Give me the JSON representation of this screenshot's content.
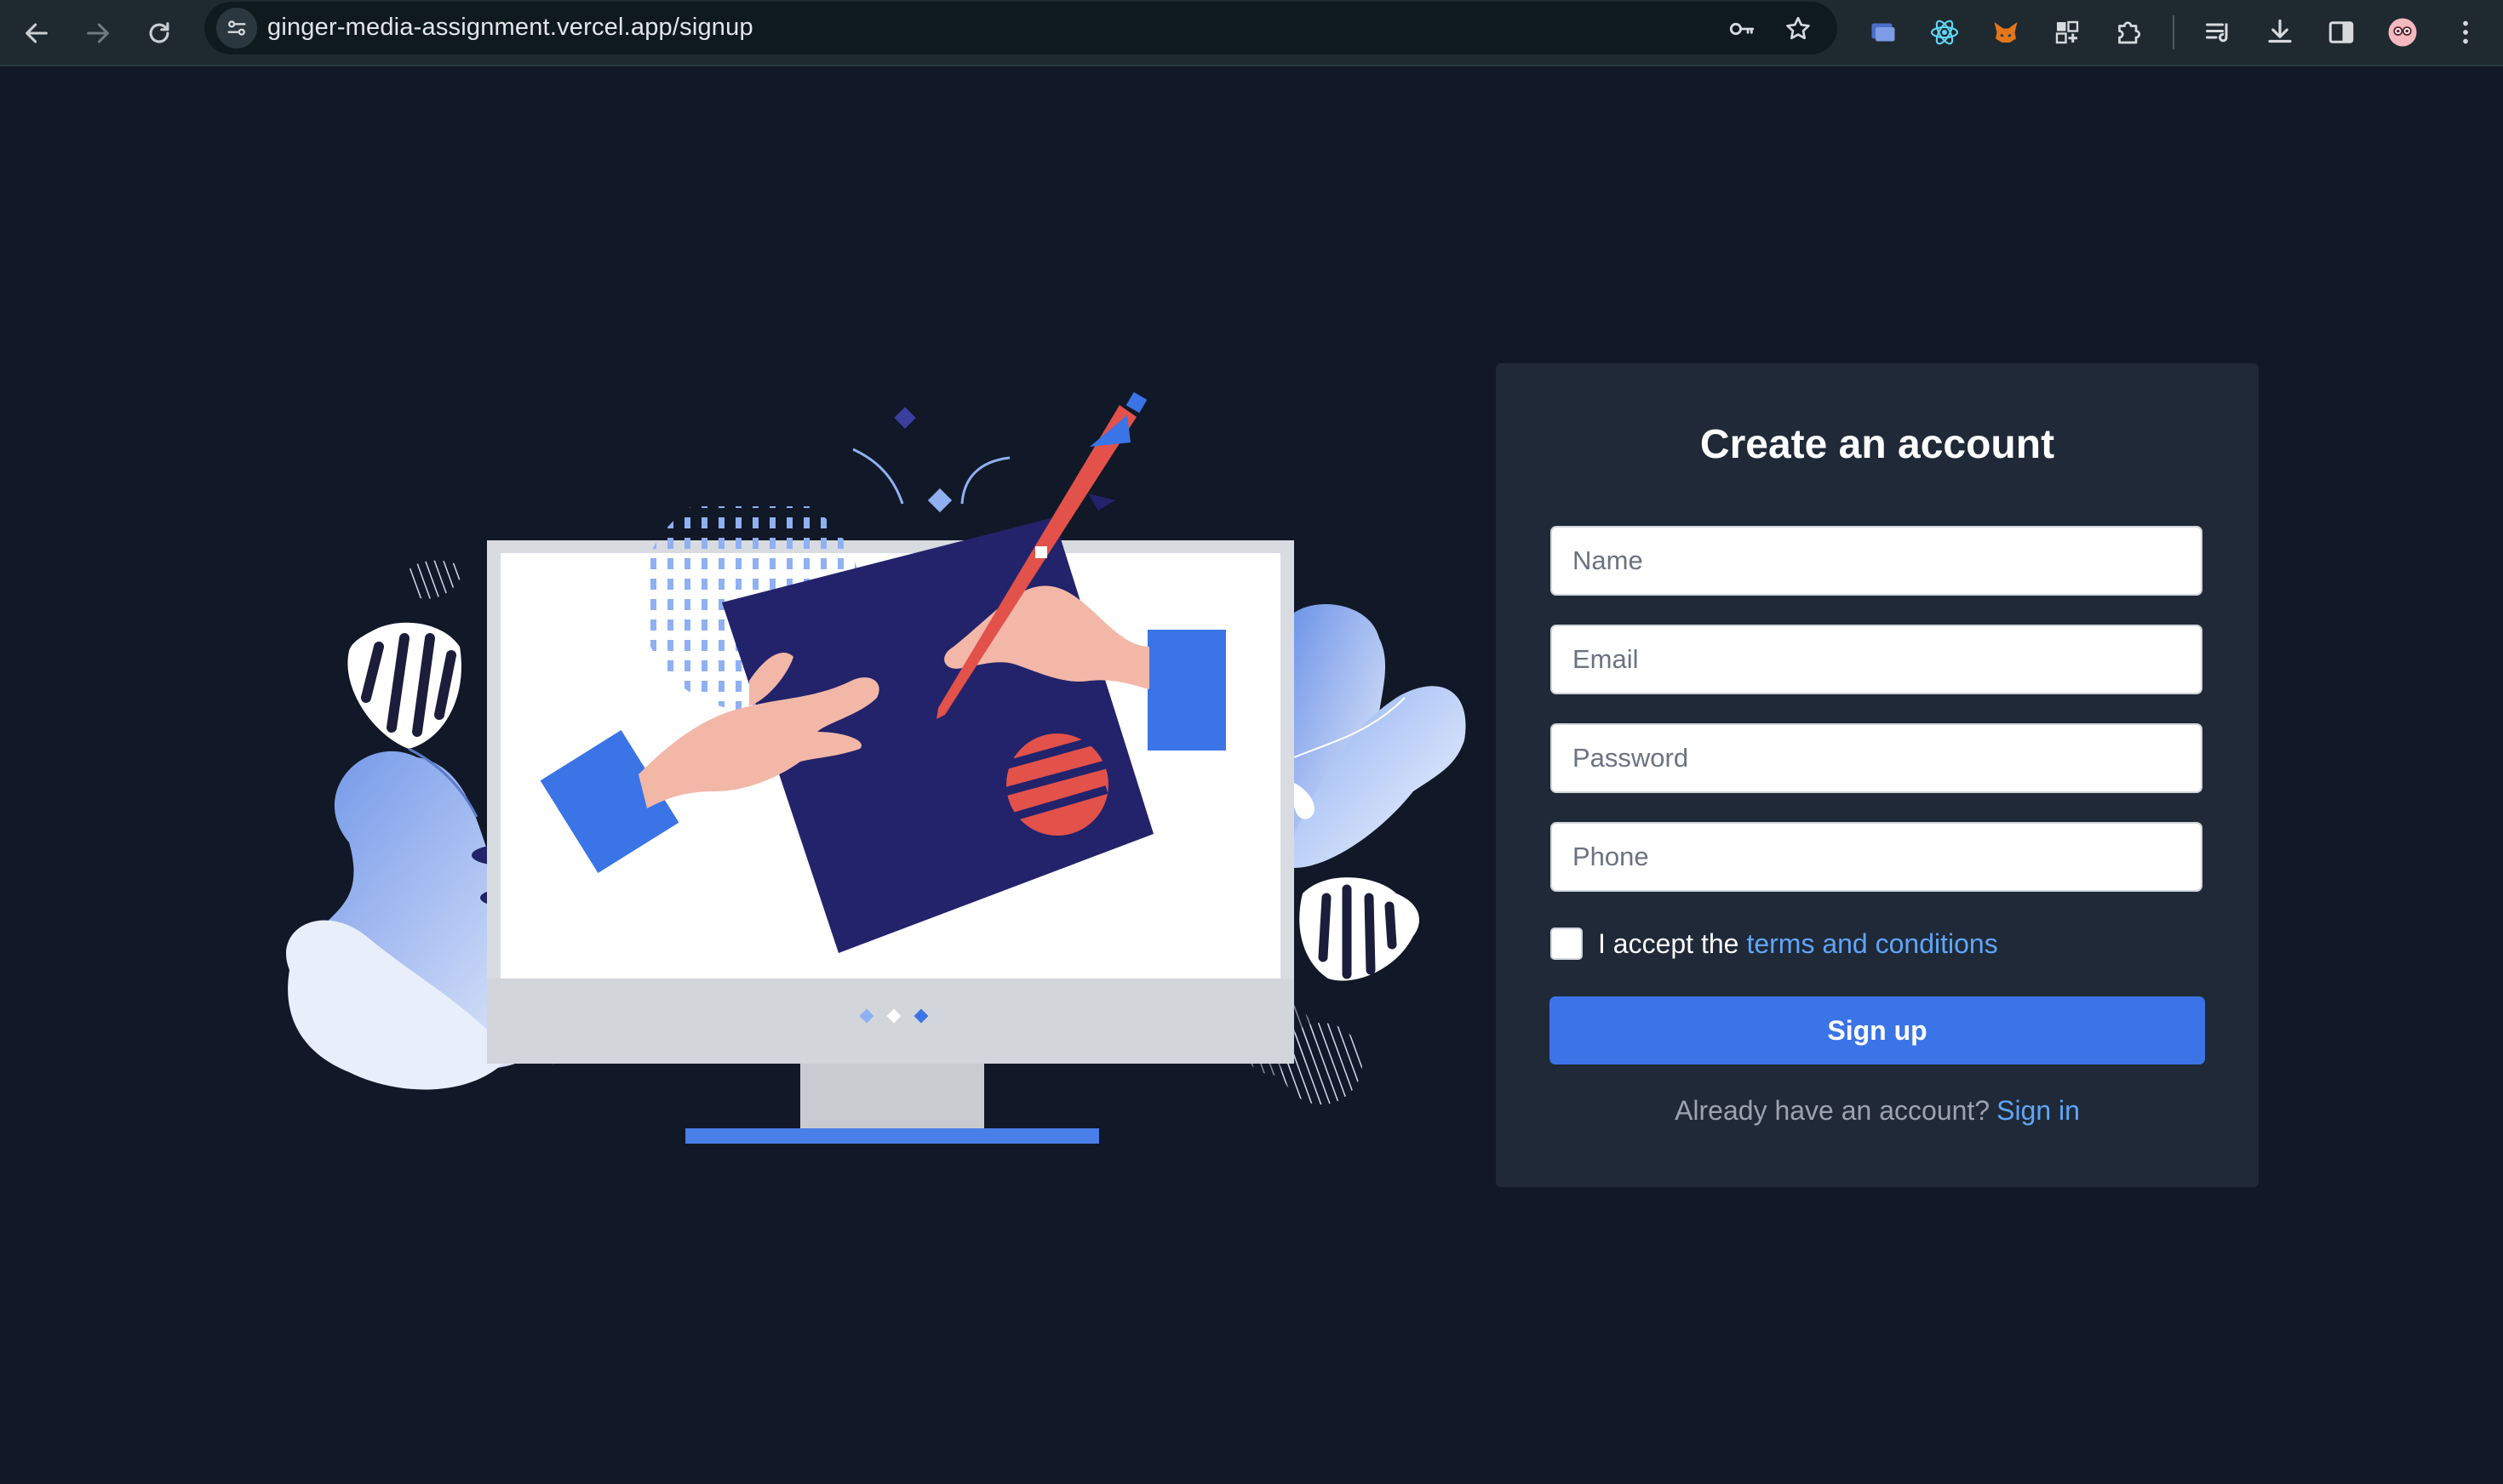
{
  "browser": {
    "url": "ginger-media-assignment.vercel.app/signup",
    "nav_icons": [
      "back-arrow-icon",
      "forward-arrow-icon",
      "reload-icon"
    ],
    "url_icons": [
      "site-settings-icon",
      "password-key-icon",
      "bookmark-star-icon"
    ],
    "extensions": [
      "extension-window-icon",
      "react-devtools-icon",
      "metamask-fox-icon",
      "extension-grid-icon",
      "extensions-puzzle-icon",
      "reading-list-icon",
      "download-icon",
      "side-panel-icon",
      "profile-avatar-icon",
      "menu-kebab-icon"
    ]
  },
  "signup_card": {
    "title": "Create an account",
    "fields": {
      "name_placeholder": "Name",
      "email_placeholder": "Email",
      "password_placeholder": "Password",
      "phone_placeholder": "Phone"
    },
    "terms_text": "I accept the",
    "terms_link": "terms and conditions",
    "terms_checked": false,
    "submit_label": "Sign up",
    "signin_prompt": "Already have an account?",
    "signin_link": "Sign in"
  },
  "colors": {
    "page_background": "#111827",
    "card_background": "#1f2937",
    "accent_blue": "#3b74e6",
    "link_blue": "#60a5fa",
    "illustration_navy": "#22236b",
    "illustration_red": "#e2514a"
  }
}
